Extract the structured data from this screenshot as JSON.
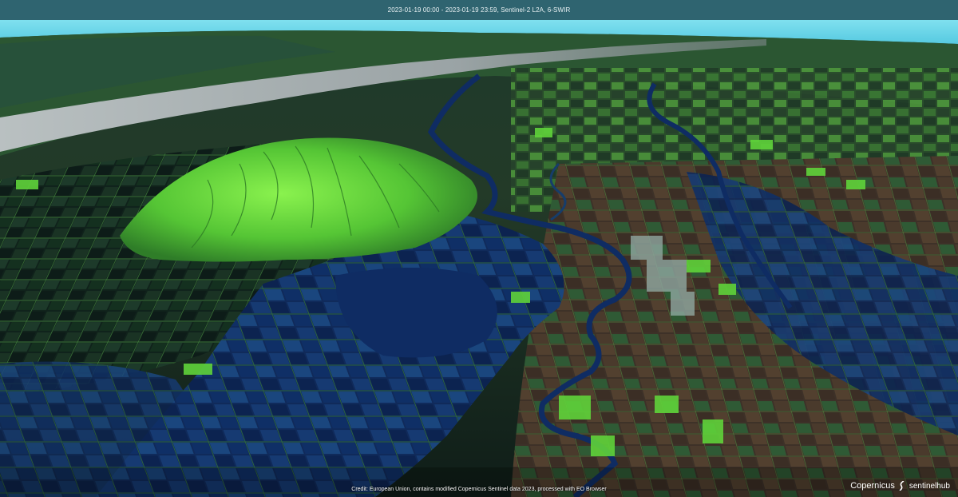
{
  "header": {
    "caption": "2023-01-19 00:00 - 2023-01-19 23:59, Sentinel-2 L2A, 6-SWIR"
  },
  "footer": {
    "credit": "Credit: European Union, contains modified Copernicus Sentinel data 2023, processed with EO Browser",
    "logo_copernicus": "Copernicus",
    "logo_sentinelhub": "sentinelhub"
  },
  "colors": {
    "header_bar": "#2f6470",
    "sky": "#5fd3e8",
    "flood_water": "#0f2c63",
    "vegetation": "#5fd33a",
    "dry_land": "#4a3a2c",
    "clouds": "#a9b1b3"
  },
  "icons": [
    "copernicus-logo-icon",
    "sentinelhub-logo-icon"
  ]
}
